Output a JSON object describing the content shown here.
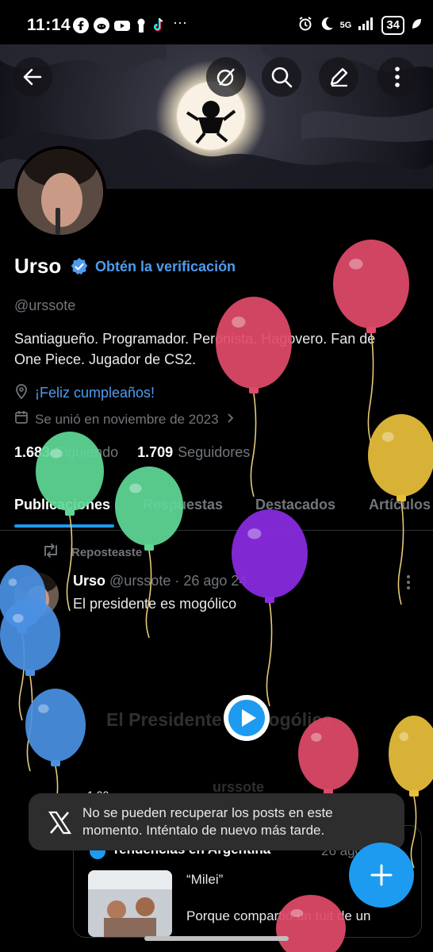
{
  "status_bar": {
    "time": "11:14",
    "dots": "···",
    "network": "5G",
    "battery": "34",
    "icons": [
      "facebook-icon",
      "reddit-icon",
      "youtube-icon",
      "notification-icon",
      "tiktok-icon",
      "alarm-icon",
      "moon-icon",
      "signal-icon",
      "leaf-icon"
    ]
  },
  "header": {
    "buttons": [
      "back-icon",
      "grok-icon",
      "search-icon",
      "edit-icon",
      "more-icon"
    ]
  },
  "profile": {
    "name": "Urso",
    "verify_link": "Obtén la verificación",
    "handle": "@urssote",
    "bio_line1": "Santiagueño. Programador. Peronista. Hagovero. Fan de",
    "bio_line2": "One Piece. Jugador de CS2.",
    "birthday": "¡Feliz cumpleaños!",
    "joined": "Se unió en noviembre de 2023",
    "following_count": "1.683",
    "following_label": "Siguiendo",
    "followers_count": "1.709",
    "followers_label": "Seguidores"
  },
  "tabs": [
    "Publicaciones",
    "Respuestas",
    "Destacados",
    "Artículos"
  ],
  "post": {
    "repost_label": "Reposteaste",
    "author": "Urso",
    "handle_date": "@urssote · 26 ago 24",
    "text": "El presidente es mogólico",
    "video_caption": "El Presidente es mogólico",
    "video_user": "urssote",
    "count": "1,00",
    "quote_name": "Tendencias en Argentina",
    "quote_date": "26 ago",
    "quote_title": "“Milei”",
    "quote_body": "Porque compartió un tuit de un"
  },
  "toast": {
    "text": "No se pueden recuperar los posts en este momento. Inténtalo de nuevo más tarde."
  },
  "colors": {
    "accent": "#1d9bf0",
    "link": "#4d9cf0",
    "muted": "#71767b",
    "balloon_red": "#e04a68",
    "balloon_green": "#5fd796",
    "balloon_yellow": "#e8bf3a",
    "balloon_purple": "#8a2be2",
    "balloon_blue": "#4a90e2"
  }
}
